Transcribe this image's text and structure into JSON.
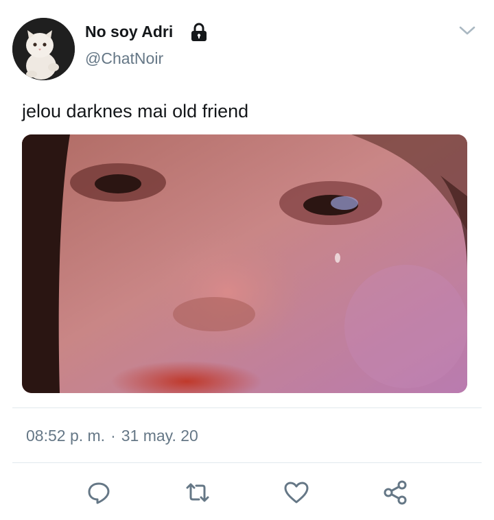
{
  "tweet": {
    "author": {
      "display_name": "No soy Adri",
      "handle": "@ChatNoir",
      "protected_icon": "lock-icon",
      "avatar": "white-cat-avatar"
    },
    "text": "jelou darknes mai old friend",
    "media": "close-up photo of a crying face",
    "time": "08:52 p. m.",
    "separator": "·",
    "date": "31 may. 20"
  },
  "menu": {
    "icon": "chevron-down-icon"
  },
  "actions": [
    {
      "name": "reply",
      "icon": "reply-icon"
    },
    {
      "name": "retweet",
      "icon": "retweet-icon"
    },
    {
      "name": "like",
      "icon": "heart-icon"
    },
    {
      "name": "share",
      "icon": "share-icon"
    }
  ],
  "colors": {
    "text": "#14171a",
    "secondary": "#657786",
    "divider": "#e1e8ed",
    "icon": "#657786"
  }
}
